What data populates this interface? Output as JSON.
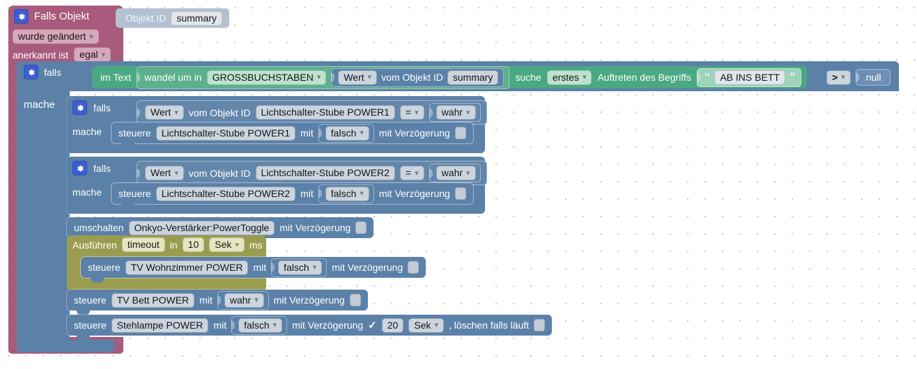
{
  "app": {
    "name": "blockly-script-editor",
    "language": "de"
  },
  "colors": {
    "trigger": "#a85b7c",
    "logic": "#5b81a8",
    "action": "#5b81a8",
    "text": "#4aa883",
    "timer": "#9a9c4f",
    "object_id": "#b3c1d1",
    "null_value": "#6e8fb5",
    "canvas": "#ffffff",
    "grid_dot": "#cfcbcb"
  },
  "trigger_block": {
    "icon": "gear-icon",
    "title": "Falls Objekt",
    "object_id_label": "Objekt ID",
    "object_id_value": "summary",
    "change_mode": "wurde geändert",
    "ack_label": "anerkannt ist",
    "ack_value": "egal",
    "do_label": "mache"
  },
  "outer_if": {
    "icon": "gear-icon",
    "keyword": "falls",
    "do_label": "mache",
    "condition": {
      "text_block": {
        "prefix": "im Text",
        "transform_label": "wandel um in",
        "transform_value": "GROSSBUCHSTABEN",
        "value_selector": "Wert",
        "object_prefix": "vom Objekt ID",
        "object_id": "summary",
        "search_label": "suche",
        "occurrence": "erstes",
        "occurrence_suffix": "Auftreten des Begriffs",
        "search_term": "AB INS BETT",
        "quote_open": "“",
        "quote_close": "”"
      },
      "operator": ">",
      "compare_to": "null"
    }
  },
  "nested_ifs": [
    {
      "icon": "gear-icon",
      "keyword": "falls",
      "do_label": "mache",
      "value_selector": "Wert",
      "object_prefix": "vom Objekt ID",
      "object_id": "Lichtschalter-Stube POWER1",
      "operator": "=",
      "compare_to": "wahr",
      "action": {
        "verb": "steuere",
        "target": "Lichtschalter-Stube POWER1",
        "with_label": "mit",
        "value": "falsch",
        "delay_label": "mit Verzögerung",
        "delay_enabled": false
      }
    },
    {
      "icon": "gear-icon",
      "keyword": "falls",
      "do_label": "mache",
      "value_selector": "Wert",
      "object_prefix": "vom Objekt ID",
      "object_id": "Lichtschalter-Stube POWER2",
      "operator": "=",
      "compare_to": "wahr",
      "action": {
        "verb": "steuere",
        "target": "Lichtschalter-Stube POWER2",
        "with_label": "mit",
        "value": "falsch",
        "delay_label": "mit Verzögerung",
        "delay_enabled": false
      }
    }
  ],
  "toggle_statement": {
    "verb": "umschalten",
    "target": "Onkyo-Verstärker:PowerToggle",
    "delay_label": "mit Verzögerung",
    "delay_enabled": false
  },
  "timeout_block": {
    "verb": "Ausführen",
    "name": "timeout",
    "in_label": "in",
    "amount": "10",
    "unit": "Sek",
    "unit_suffix": "ms",
    "body": {
      "verb": "steuere",
      "target": "TV Wohnzimmer POWER",
      "with_label": "mit",
      "value": "falsch",
      "delay_label": "mit Verzögerung",
      "delay_enabled": false
    }
  },
  "trailing_statements": [
    {
      "verb": "steuere",
      "target": "TV Bett POWER",
      "with_label": "mit",
      "value": "wahr",
      "delay_label": "mit Verzögerung",
      "delay_enabled": false,
      "has_timer": false
    },
    {
      "verb": "steuere",
      "target": "Stehlampe POWER",
      "with_label": "mit",
      "value": "falsch",
      "delay_label": "mit Verzögerung",
      "delay_enabled": true,
      "delay_check": "✓",
      "delay_amount": "20",
      "delay_unit": "Sek",
      "clear_label": ", löschen falls läuft",
      "clear_enabled": false,
      "has_timer": true
    }
  ]
}
